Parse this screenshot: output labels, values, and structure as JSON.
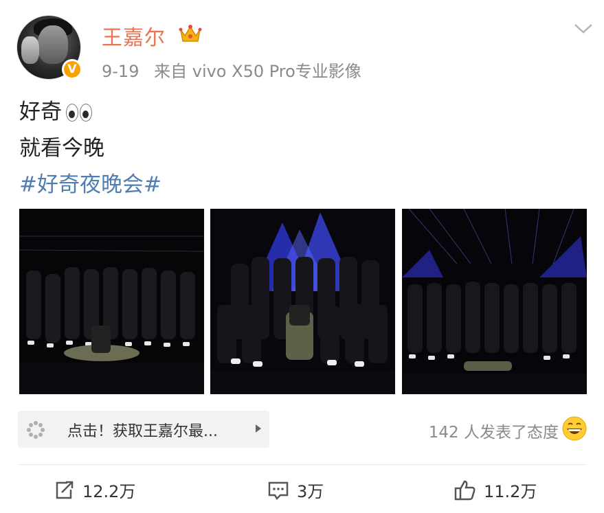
{
  "post": {
    "author": "王嘉尔",
    "verified_badge": "V",
    "date": "9-19",
    "source": "来自 vivo X50 Pro专业影像",
    "text_line1": "好奇",
    "text_line2": "就看今晚",
    "hashtag": "#好奇夜晚会#"
  },
  "icons": {
    "crown": "crown-icon",
    "dropdown": "chevron-down-icon",
    "eyes": "eyes-emoji-icon"
  },
  "photos": [
    {
      "label": "group-photo-1"
    },
    {
      "label": "group-photo-2"
    },
    {
      "label": "group-photo-3"
    }
  ],
  "promo_bar": {
    "text": "点击！获取王嘉尔最..."
  },
  "reactions": {
    "summary": "142 人发表了态度"
  },
  "actions": {
    "repost_count": "12.2万",
    "comment_count": "3万",
    "like_count": "11.2万"
  },
  "colors": {
    "name": "#eb7350",
    "hashtag": "#507daf",
    "badge": "#f7a200",
    "meta": "#8a8a8a"
  }
}
